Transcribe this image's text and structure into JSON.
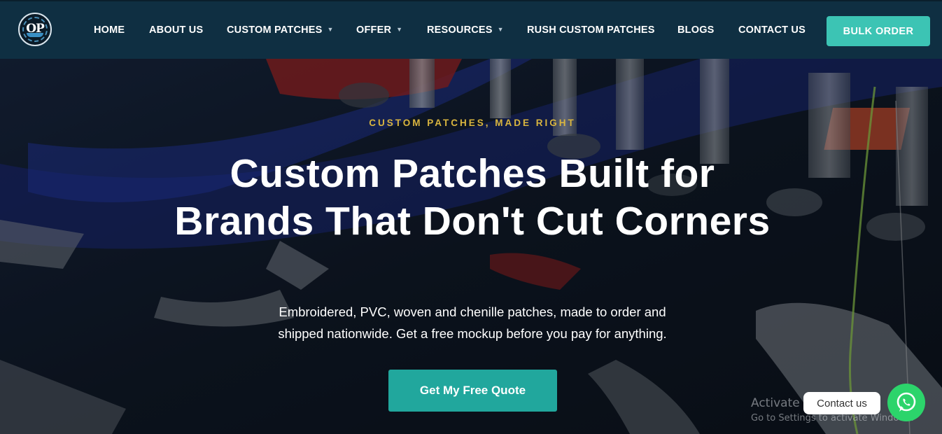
{
  "brand": {
    "logo_mark": "OP",
    "logo_ring_text": "OCEAN PATCHES"
  },
  "nav": {
    "items": [
      {
        "label": "HOME",
        "has_dropdown": false
      },
      {
        "label": "ABOUT US",
        "has_dropdown": false
      },
      {
        "label": "CUSTOM PATCHES",
        "has_dropdown": true
      },
      {
        "label": "OFFER",
        "has_dropdown": true
      },
      {
        "label": "RESOURCES",
        "has_dropdown": true
      },
      {
        "label": "RUSH CUSTOM PATCHES",
        "has_dropdown": false
      },
      {
        "label": "BLOGS",
        "has_dropdown": false
      },
      {
        "label": "CONTACT US",
        "has_dropdown": false
      }
    ],
    "cta_label": "BULK ORDER",
    "caret_icon": "chevron-down-icon"
  },
  "hero": {
    "eyebrow": "CUSTOM PATCHES, MADE RIGHT",
    "headline": "Custom Patches Built for Brands That Don't Cut Corners",
    "subtext": "Embroidered, PVC, woven and chenille patches, made to order and shipped nationwide. Get a free mockup before you pay for anything.",
    "cta_label": "Get My Free Quote",
    "background": "embroidery-machine-photo"
  },
  "widgets": {
    "contact_label": "Contact us",
    "whatsapp_icon": "whatsapp-icon"
  },
  "watermark": {
    "line1": "Activate Windows",
    "line2": "Go to Settings to activate Windows."
  },
  "colors": {
    "header_bg": "#0f2f42",
    "accent_teal": "#3cc4b4",
    "quote_button": "#21a79d",
    "eyebrow_gold": "#d9b53f",
    "whatsapp_green": "#2cd46b"
  }
}
